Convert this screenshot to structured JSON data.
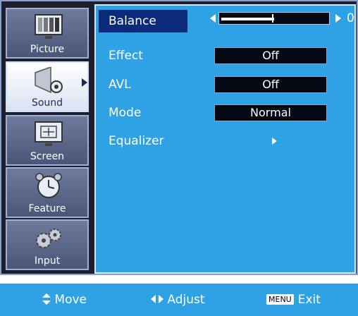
{
  "sidebar": {
    "items": [
      {
        "label": "Picture",
        "icon": "tv-picture-icon",
        "active": false
      },
      {
        "label": "Sound",
        "icon": "speaker-icon",
        "active": true
      },
      {
        "label": "Screen",
        "icon": "screen-adjust-icon",
        "active": false
      },
      {
        "label": "Feature",
        "icon": "alarm-clock-icon",
        "active": false
      },
      {
        "label": "Input",
        "icon": "gears-icon",
        "active": false
      }
    ]
  },
  "menu": {
    "balance": {
      "label": "Balance",
      "value": "0",
      "level_fraction": 0.5
    },
    "effect": {
      "label": "Effect",
      "value": "Off"
    },
    "avl": {
      "label": "AVL",
      "value": "Off"
    },
    "mode": {
      "label": "Mode",
      "value": "Normal"
    },
    "equalizer": {
      "label": "Equalizer"
    }
  },
  "footer": {
    "move": "Move",
    "adjust": "Adjust",
    "menu_key": "MENU",
    "exit": "Exit"
  },
  "colors": {
    "panel": "#2fa2e6",
    "selection": "#0b2a7a",
    "frame": "#1c1f2e"
  }
}
